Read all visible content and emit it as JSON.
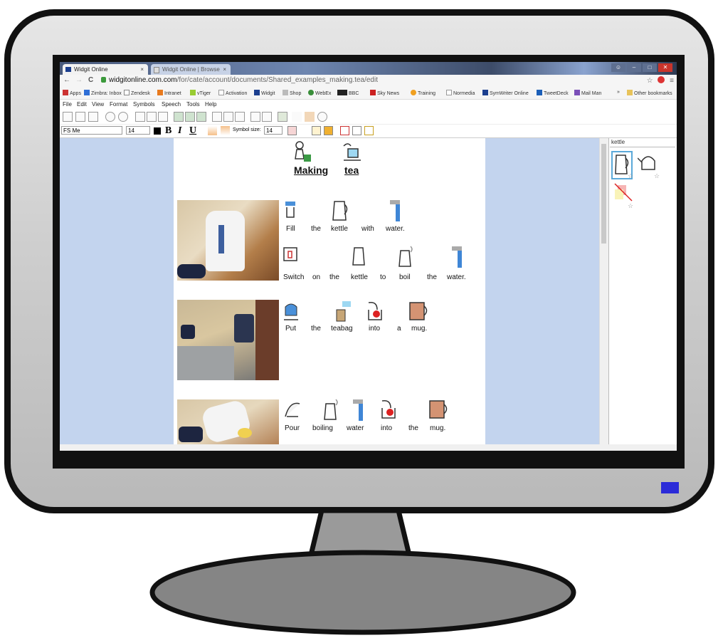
{
  "browser": {
    "tabs": [
      {
        "label": "Widgit Online"
      },
      {
        "label": "Widgit Online | Browse"
      }
    ],
    "address": {
      "host": "widgitonline.com.com",
      "path": "/for/cate/account/documents/Shared_examples_making.tea/edit"
    },
    "bookmarks": [
      {
        "label": "Apps"
      },
      {
        "label": "Zimbra: Inbox"
      },
      {
        "label": "Zendesk"
      },
      {
        "label": "Intranet"
      },
      {
        "label": "vTiger"
      },
      {
        "label": "Activation"
      },
      {
        "label": "Widgit"
      },
      {
        "label": "Shop"
      },
      {
        "label": "WebEx"
      },
      {
        "label": "BBC"
      },
      {
        "label": "Sky News"
      },
      {
        "label": "Training"
      },
      {
        "label": "Normedia"
      },
      {
        "label": "SymWriter Online"
      },
      {
        "label": "TweetDeck"
      },
      {
        "label": "Mail Man"
      },
      {
        "label": "»"
      },
      {
        "label": "Other bookmarks"
      }
    ]
  },
  "menu": [
    "File",
    "Edit",
    "View",
    "Format",
    "Symbols",
    "Speech",
    "Tools",
    "Help"
  ],
  "format_bar": {
    "font": "FS Me",
    "size": "14",
    "symbol_size_label": "Symbol size:",
    "symbol_size": "14"
  },
  "document": {
    "title_words": [
      "Making",
      "tea"
    ],
    "lines": [
      [
        "Fill",
        "the",
        "kettle",
        "with",
        "water."
      ],
      [
        "Switch",
        "on",
        "the",
        "kettle",
        "to",
        "boil",
        "the",
        "water."
      ],
      [
        "Put",
        "the",
        "teabag",
        "into",
        "a",
        "mug."
      ],
      [
        "Pour",
        "boiling",
        "water",
        "into",
        "the",
        "mug."
      ]
    ]
  },
  "symbol_panel": {
    "search": "kettle"
  },
  "colors": {
    "doc_background": "#c3d4ee",
    "power_led": "#2b2bd8",
    "monitor_outline": "#111111"
  }
}
